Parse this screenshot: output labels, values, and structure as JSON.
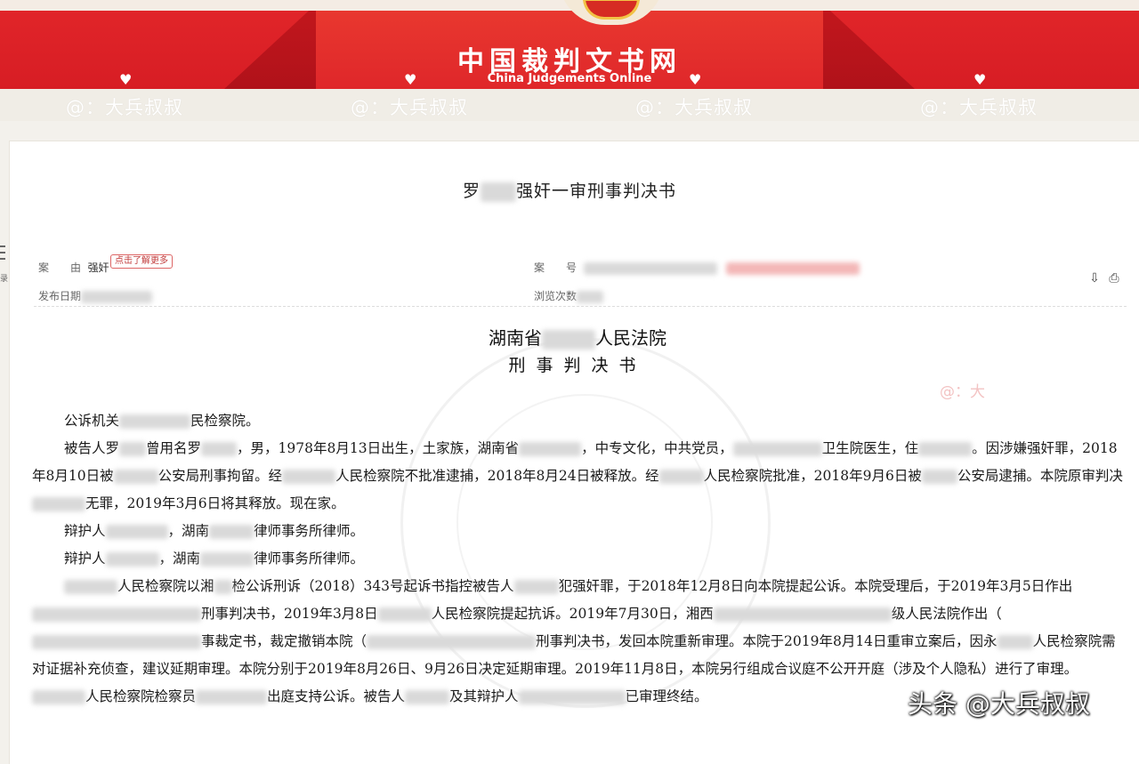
{
  "banner": {
    "site_name_cn": "中国裁判文书网",
    "site_name_en": "China Judgements Online",
    "watermark": "@：大兵叔叔"
  },
  "document": {
    "title_prefix": "罗",
    "title_suffix": "强奸一审刑事判决书",
    "meta": {
      "case_cause_label": "案　　由",
      "case_cause_value": "强奸",
      "more_tag": "点击了解更多",
      "case_no_label": "案　　号",
      "publish_date_label": "发布日期",
      "views_label": "浏览次数"
    },
    "court_name_prefix": "湖南省",
    "court_name_suffix": "人民法院",
    "doc_type": "刑事判决书",
    "side_watermark": "@：大"
  },
  "body": {
    "p1a": "公诉机关",
    "p1b": "民检察院。",
    "p2a": "被告人罗",
    "p2b": "曾用名罗",
    "p2c": "，男，1978年8月13日出生，土家族，湖南省",
    "p2d": "，中专文化，中共党员，",
    "p2e": "卫生院医生，住",
    "p2f": "。因涉嫌强奸罪，2018年8月10日被",
    "p2g": "公安局刑事拘留。经",
    "p2h": "人民检察院不批准逮捕，2018年8月24日被释放。经",
    "p2i": "人民检察院批准，2018年9月6日被",
    "p2j": "公安局逮捕。本院原审判决",
    "p2k": "无罪，2019年3月6日将其释放。现在家。",
    "p3a": "辩护人",
    "p3b": "，湖南",
    "p3c": "律师事务所律师。",
    "p4a": "辩护人",
    "p4b": "，湖南",
    "p4c": "律师事务所律师。",
    "p5a": "人民检察院以湘",
    "p5b": "检公诉刑诉（2018）343号起诉书指控被告人",
    "p5c": "犯强奸罪，于2018年12月8日向本院提起公诉。本院受理后，于2019年3月5日作出",
    "p5d": "刑事判决书，2019年3月8日",
    "p5e": "人民检察院提起抗诉。2019年7月30日，湘西",
    "p5f": "级人民法院作出（",
    "p5g": "事裁定书，裁定撤销本院（",
    "p5h": "刑事判决书，发回本院重新审理。本院于2019年8月14日重审立案后，因永",
    "p5i": "人民检察院需对证据补充侦查，建议延期审理。本院分别于2019年8月26日、9月26日决定延期审理。2019年11月8日，本院另行组成合议庭不公开开庭（涉及个人隐私）进行了审理。",
    "p5j": "人民检察院检察员",
    "p5k": "出庭支持公诉。被告人",
    "p5l": "及其辩护人",
    "p5m": "已审理终结。"
  },
  "overlay": {
    "corner_watermark": "头条 @大兵叔叔"
  },
  "colors": {
    "banner_red": "#c4171d",
    "ribbon_red": "#e2262a",
    "tag_red": "#c23b3b"
  }
}
